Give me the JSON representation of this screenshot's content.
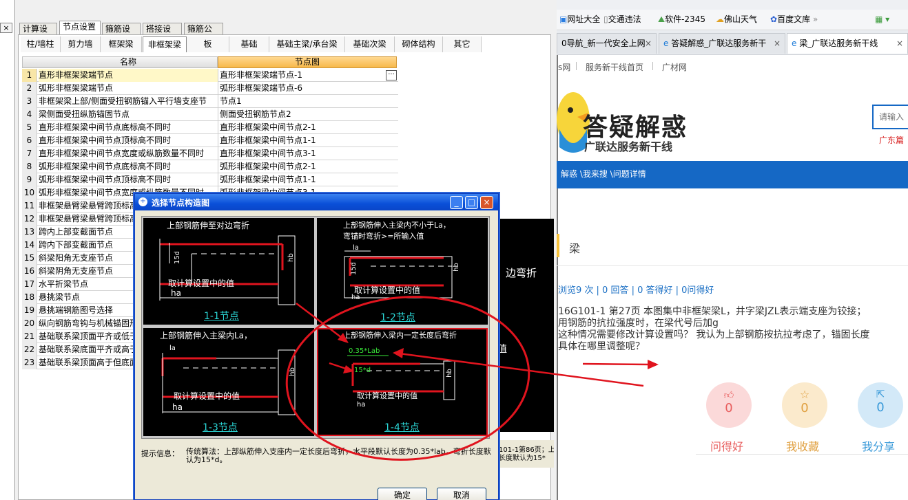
{
  "app": {
    "main_tabs": [
      "计算设置",
      "节点设置",
      "箍筋设置",
      "搭接设置",
      "箍筋公式"
    ],
    "sub_tabs": [
      "柱/墙柱",
      "剪力墙",
      "框架梁",
      "非框架梁",
      "板",
      "基础",
      "基础主梁/承台梁",
      "基础次梁",
      "砌体结构",
      "其它"
    ],
    "table": {
      "col_name": "名称",
      "col_node": "节点图",
      "rows": [
        {
          "no": "1",
          "name": "直形非框架梁端节点",
          "node": "直形非框架梁端节点-1"
        },
        {
          "no": "2",
          "name": "弧形非框架梁端节点",
          "node": "弧形非框架梁端节点-6"
        },
        {
          "no": "3",
          "name": "非框架梁上部/侧面受扭钢筋锚入平行墙支座节",
          "node": "节点1"
        },
        {
          "no": "4",
          "name": "梁侧面受扭纵筋锚固节点",
          "node": "侧面受扭钢筋节点2"
        },
        {
          "no": "5",
          "name": "直形非框架梁中间节点底标高不同时",
          "node": "直形非框架梁中间节点2-1"
        },
        {
          "no": "6",
          "name": "直形非框架梁中间节点顶标高不同时",
          "node": "直形非框架梁中间节点1-1"
        },
        {
          "no": "7",
          "name": "直形非框架梁中间节点宽度或纵筋数量不同时",
          "node": "直形非框架梁中间节点3-1"
        },
        {
          "no": "8",
          "name": "弧形非框架梁中间节点底标高不同时",
          "node": "弧形非框架梁中间节点2-1"
        },
        {
          "no": "9",
          "name": "弧形非框架梁中间节点顶标高不同时",
          "node": "弧形非框架梁中间节点1-1"
        },
        {
          "no": "10",
          "name": "弧形非框架梁中间节点宽度或纵筋数量不同时",
          "node": "弧形非框架梁中间节点3-1"
        },
        {
          "no": "11",
          "name": "非框架悬臂梁悬臂跨顶标高",
          "node": ""
        },
        {
          "no": "12",
          "name": "非框架悬臂梁悬臂跨顶标高",
          "node": ""
        },
        {
          "no": "13",
          "name": "跨内上部变截面节点",
          "node": ""
        },
        {
          "no": "14",
          "name": "跨内下部变截面节点",
          "node": ""
        },
        {
          "no": "15",
          "name": "斜梁阳角无支座节点",
          "node": ""
        },
        {
          "no": "16",
          "name": "斜梁阴角无支座节点",
          "node": ""
        },
        {
          "no": "17",
          "name": "水平折梁节点",
          "node": ""
        },
        {
          "no": "18",
          "name": "悬挑梁节点",
          "node": ""
        },
        {
          "no": "19",
          "name": "悬挑端钢筋图号选择",
          "node": ""
        },
        {
          "no": "20",
          "name": "纵向钢筋弯钩与机械锚固形",
          "node": ""
        },
        {
          "no": "21",
          "name": "基础联系梁顶面平齐或低于",
          "node": ""
        },
        {
          "no": "22",
          "name": "基础联系梁底面平齐或高于",
          "node": ""
        },
        {
          "no": "23",
          "name": "基础联系梁顶面高于但底面",
          "node": ""
        }
      ]
    },
    "ellipsis": "···"
  },
  "dialog": {
    "title": "选择节点构造图",
    "options": [
      {
        "caption": "上部钢筋伸至对边弯折",
        "caption2": "",
        "label": "1-1节点",
        "sub": "取计算设置中的值",
        "dims": [
          "15d",
          "hb",
          "ha"
        ]
      },
      {
        "caption": "上部钢筋伸入主梁内不小于La，",
        "caption2": "弯锚时弯折>=所输入值",
        "label": "1-2节点",
        "sub": "取计算设置中的值",
        "dims": [
          "la",
          "15d",
          "hb",
          "ha"
        ]
      },
      {
        "caption": "上部钢筋伸入主梁内La，",
        "caption2": "",
        "label": "1-3节点",
        "sub": "取计算设置中的值",
        "dims": [
          "la",
          "hb",
          "ha"
        ]
      },
      {
        "caption": "上部钢筋伸入梁内一定长度后弯折",
        "caption2": "",
        "label": "1-4节点",
        "sub": "取计算设置中的值",
        "dims": [
          "0.35*Lab",
          "15*d",
          "hb",
          "ha"
        ]
      }
    ],
    "hint_label": "提示信息：",
    "hint_text": "传统算法：上部纵筋伸入支座内一定长度后弯折，水平段默认长度为0.35*lab，弯折长度默认为15*d。",
    "ok": "确定",
    "cancel": "取消",
    "ghost_caption": "边弯折",
    "ghost_value": "值",
    "ghost_hint1": "101-1第86页；上",
    "ghost_hint2": "长度默认为15*"
  },
  "browser": {
    "favorites": [
      "网址大全",
      "交通违法",
      "软件-2345",
      "佛山天气",
      "百度文库"
    ],
    "tabs": [
      {
        "title": "0导航_新一代安全上网",
        "active": false
      },
      {
        "title": "答疑解惑_广联达服务新干",
        "active": false
      },
      {
        "title": "梁_广联达服务新干线",
        "active": true
      }
    ],
    "subnav": [
      "s网",
      "服务新干线首页",
      "广材网"
    ],
    "logo_title": "答疑解惑",
    "logo_sub": "广联达服务新干线",
    "search_placeholder": "请输入",
    "region": "广东篇",
    "breadcrumb": "解惑 \\我来搜 \\问题详情",
    "category": "梁",
    "stats": "浏览9 次 | 0 回答 | 0 答得好 | 0问得好",
    "question": [
      "16G101-1  第27页  本图集中非框架梁L，井字梁JZL表示端支座为铰接；",
      "用钢筋的抗拉强度时，在梁代号后加g",
      "这种情况需要修改计算设置吗？ 我认为上部钢筋按抗拉考虑了，锚固长度",
      "具体在哪里调整呢？"
    ],
    "actions": [
      {
        "icon": "thumbs-up",
        "count": "0",
        "label": "问得好",
        "color": "#e85d5d"
      },
      {
        "icon": "star",
        "count": "0",
        "label": "我收藏",
        "color": "#e0a040"
      },
      {
        "icon": "share",
        "count": "0",
        "label": "我分享",
        "color": "#3a9ad9"
      }
    ]
  },
  "colors": {
    "annotation_red": "#e0141e",
    "cad_cyan": "#2bd7d7",
    "cad_green": "#39e639",
    "title_blue": "#0a4fd8"
  }
}
